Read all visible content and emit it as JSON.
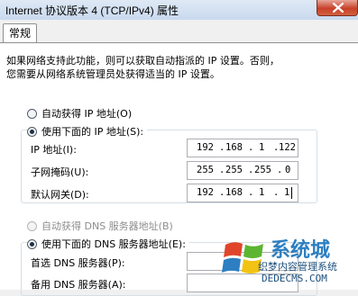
{
  "window": {
    "title": "Internet 协议版本 4 (TCP/IPv4) 属性",
    "close_icon": "close-icon"
  },
  "tabs": [
    {
      "label": "常规",
      "selected": true
    }
  ],
  "description": {
    "line1": "如果网络支持此功能，则可以获取自动指派的 IP 设置。否则，",
    "line2": "您需要从网络系统管理员处获得适当的 IP 设置。"
  },
  "ip_section": {
    "auto_label": "自动获得 IP 地址(O)",
    "manual_label": "使用下面的 IP 地址(S):",
    "selected": "manual",
    "fields": [
      {
        "label": "IP 地址(I):",
        "octets": [
          "192",
          "168",
          "1",
          "122"
        ]
      },
      {
        "label": "子网掩码(U):",
        "octets": [
          "255",
          "255",
          "255",
          "0"
        ]
      },
      {
        "label": "默认网关(D):",
        "octets": [
          "192",
          "168",
          "1",
          "1"
        ]
      }
    ]
  },
  "dns_section": {
    "auto_label": "自动获得 DNS 服务器地址(B)",
    "manual_label": "使用下面的 DNS 服务器地址(E):",
    "selected": "manual",
    "fields": [
      {
        "label": "首选 DNS 服务器(P):"
      },
      {
        "label": "备用 DNS 服务器(A):"
      }
    ]
  },
  "watermark": {
    "title": "系统城",
    "line": "织梦内容管理系统",
    "url": "DEDECMS.COM",
    "site": "xitongcheng.com",
    "colors": {
      "blue": "#2d7fc1",
      "green": "#5cb531",
      "yellow": "#f2c314",
      "red": "#e0452c"
    }
  }
}
